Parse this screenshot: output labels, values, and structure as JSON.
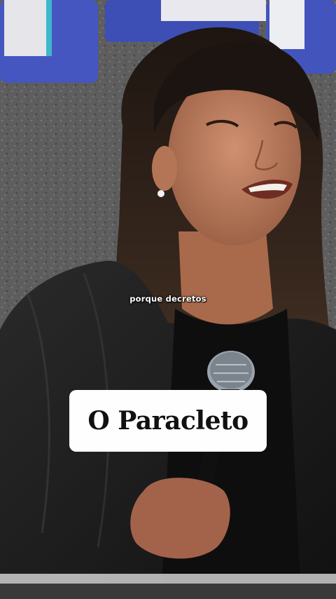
{
  "video": {
    "subtitle": "porque decretos",
    "caption": "O Paracleto"
  },
  "colors": {
    "background_wall": "#6f6f70",
    "sign_blue": "#3f4fb3",
    "jacket": "#1c1c1d",
    "skin": "#b87a5c",
    "hair": "#2a1d16",
    "caption_box": "#fefefe",
    "caption_text": "#111111"
  }
}
